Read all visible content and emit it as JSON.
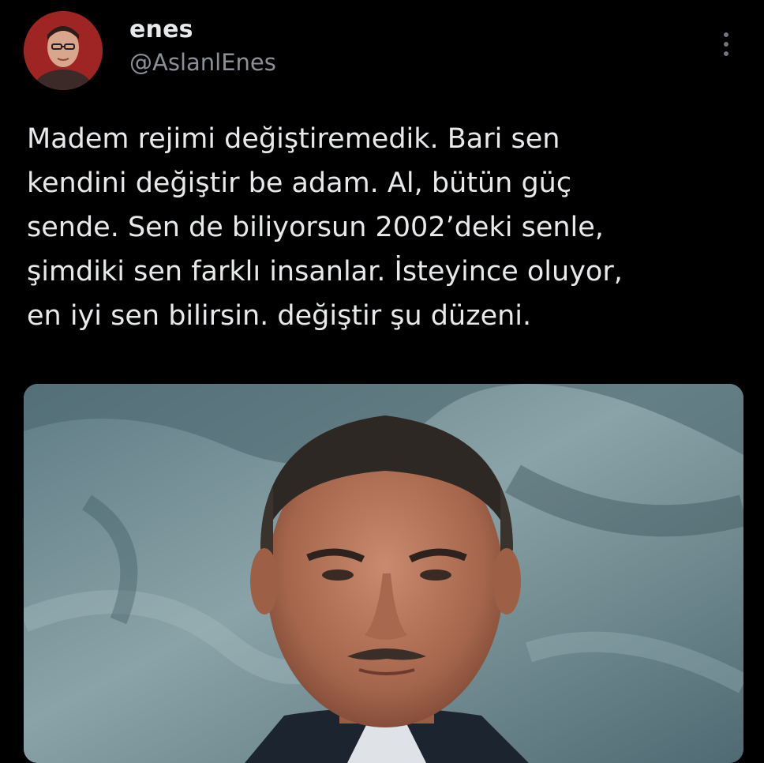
{
  "tweet": {
    "author": {
      "display_name": "enes",
      "handle": "@AslanlEnes",
      "avatar_icon": "profile-photo",
      "avatar_color": "#9e2523"
    },
    "more_icon": "more-vertical-icon",
    "text_lines": [
      "Madem rejimi değiştiremedik. Bari sen",
      "kendini değiştir be adam. Al, bütün güç",
      "sende. Sen de biliyorsun 2002’deki senle,",
      "şimdiki sen farklı insanlar. İsteyince oluyor,",
      "en iyi sen bilirsin. değiştir şu düzeni."
    ],
    "media": {
      "type": "photo",
      "background_color": "#6d8890"
    }
  },
  "theme": {
    "background": "#000000",
    "text_primary": "#e7e9ea",
    "text_secondary": "#8b9096"
  }
}
